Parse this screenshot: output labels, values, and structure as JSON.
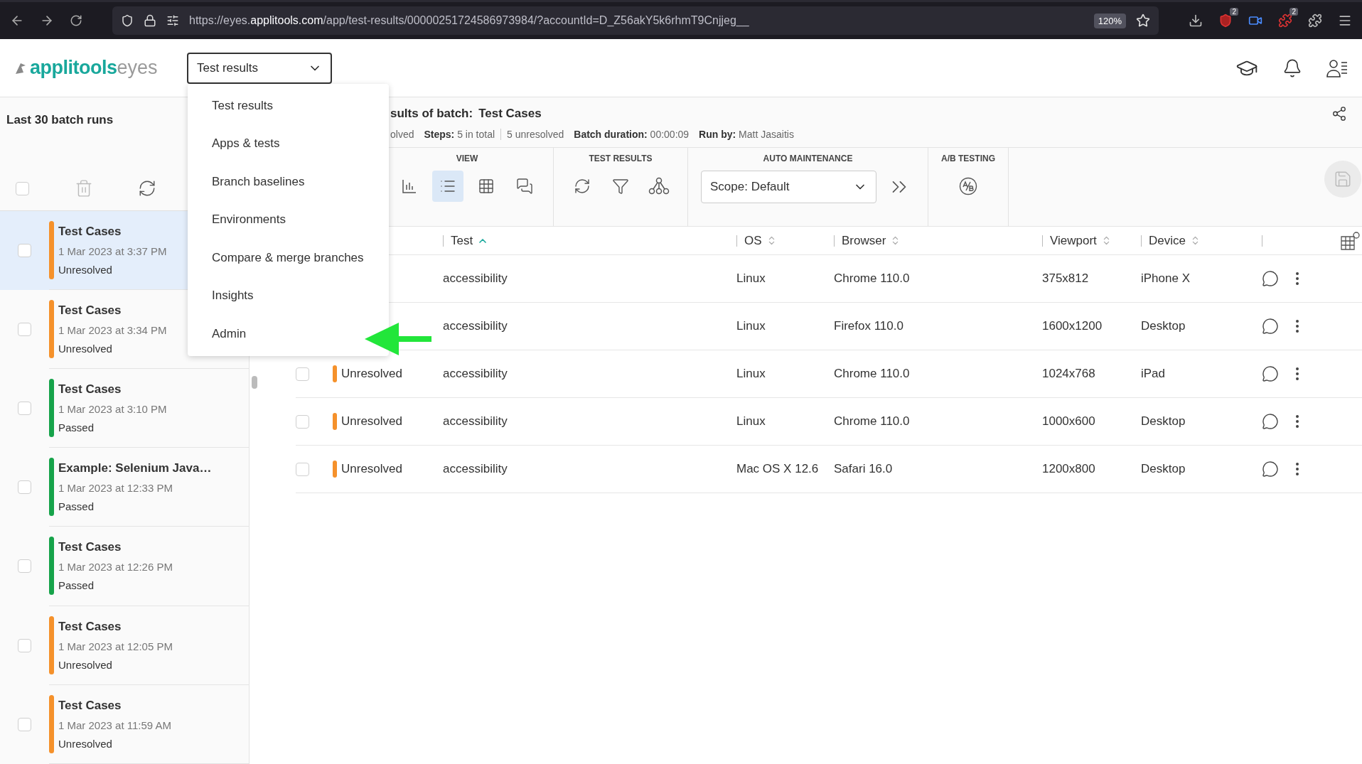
{
  "browser": {
    "url": "https://eyes.**applitools.com**/app/test-results/00000251724586973984/?accountId=D_Z56akY5k6rhmT9Cnjjeg__",
    "zoom": "120%",
    "badges": [
      "2",
      "2"
    ]
  },
  "app_header": {
    "logo_brand": "applitools",
    "logo_product": "eyes",
    "page_select": "Test results"
  },
  "nav_menu": [
    {
      "label": "Test results"
    },
    {
      "label": "Apps & tests"
    },
    {
      "label": "Branch baselines"
    },
    {
      "label": "Environments"
    },
    {
      "label": "Compare & merge branches"
    },
    {
      "label": "Insights"
    },
    {
      "label": "Admin"
    }
  ],
  "sidebar": {
    "title": "Last 30 batch runs",
    "select_all_checked": false,
    "items": [
      {
        "name": "Test Cases",
        "date": "1 Mar 2023 at 3:37 PM",
        "status": "Unresolved",
        "color": "#f5912b",
        "selected": true
      },
      {
        "name": "Test Cases",
        "date": "1 Mar 2023 at 3:34 PM",
        "status": "Unresolved",
        "color": "#f5912b",
        "selected": false
      },
      {
        "name": "Test Cases",
        "date": "1 Mar 2023 at 3:10 PM",
        "status": "Passed",
        "color": "#16a34a",
        "selected": false
      },
      {
        "name": "Example: Selenium Java…",
        "date": "1 Mar 2023 at 12:33 PM",
        "status": "Passed",
        "color": "#16a34a",
        "selected": false
      },
      {
        "name": "Test Cases",
        "date": "1 Mar 2023 at 12:26 PM",
        "status": "Passed",
        "color": "#16a34a",
        "selected": false
      },
      {
        "name": "Test Cases",
        "date": "1 Mar 2023 at 12:05 PM",
        "status": "Unresolved",
        "color": "#f5912b",
        "selected": false
      },
      {
        "name": "Test Cases",
        "date": "1 Mar 2023 at 11:59 AM",
        "status": "Unresolved",
        "color": "#f5912b",
        "selected": false
      }
    ]
  },
  "batch": {
    "title_label": "sults of batch:",
    "title_name": "Test Cases",
    "status_fragment": "olved",
    "stats": [
      {
        "label": "Steps:",
        "value": "5 in total"
      },
      {
        "value": "5 unresolved"
      },
      {
        "label": "Batch duration:",
        "value": "00:00:09"
      },
      {
        "label": "Run by:",
        "value": "Matt Jasaitis"
      }
    ]
  },
  "toolbar": [
    {
      "title": "VIEW",
      "tools": [
        {
          "kind": "chart",
          "selected": false
        },
        {
          "kind": "list",
          "selected": true
        },
        {
          "kind": "grid",
          "selected": false
        },
        {
          "kind": "comments",
          "selected": false
        }
      ]
    },
    {
      "title": "TEST RESULTS",
      "tools": [
        {
          "kind": "refresh"
        },
        {
          "kind": "filter"
        },
        {
          "kind": "branch"
        }
      ]
    },
    {
      "title": "AUTO MAINTENANCE",
      "scope": "Scope: Default",
      "tools": [
        {
          "kind": "forward"
        }
      ]
    },
    {
      "title": "A/B TESTING",
      "tools": [
        {
          "kind": "ab"
        }
      ]
    }
  ],
  "table": {
    "columns": [
      {
        "label": "Test",
        "sorted": true
      },
      {
        "label": "OS",
        "sorted": false
      },
      {
        "label": "Browser",
        "sorted": false
      },
      {
        "label": "Viewport",
        "sorted": false
      },
      {
        "label": "Device",
        "sorted": false
      }
    ],
    "rows": [
      {
        "test": "accessibility",
        "os": "Linux",
        "browser": "Chrome 110.0",
        "viewport": "375x812",
        "device": "iPhone X"
      },
      {
        "test": "accessibility",
        "os": "Linux",
        "browser": "Firefox 110.0",
        "viewport": "1600x1200",
        "device": "Desktop"
      },
      {
        "checked": false,
        "status": "Unresolved",
        "color": "#f5912b",
        "test": "accessibility",
        "os": "Linux",
        "browser": "Chrome 110.0",
        "viewport": "1024x768",
        "device": "iPad"
      },
      {
        "checked": false,
        "status": "Unresolved",
        "color": "#f5912b",
        "test": "accessibility",
        "os": "Linux",
        "browser": "Chrome 110.0",
        "viewport": "1000x600",
        "device": "Desktop"
      },
      {
        "checked": false,
        "status": "Unresolved",
        "color": "#f5912b",
        "test": "accessibility",
        "os": "Mac OS X 12.6",
        "browser": "Safari 16.0",
        "viewport": "1200x800",
        "device": "Desktop"
      }
    ]
  }
}
